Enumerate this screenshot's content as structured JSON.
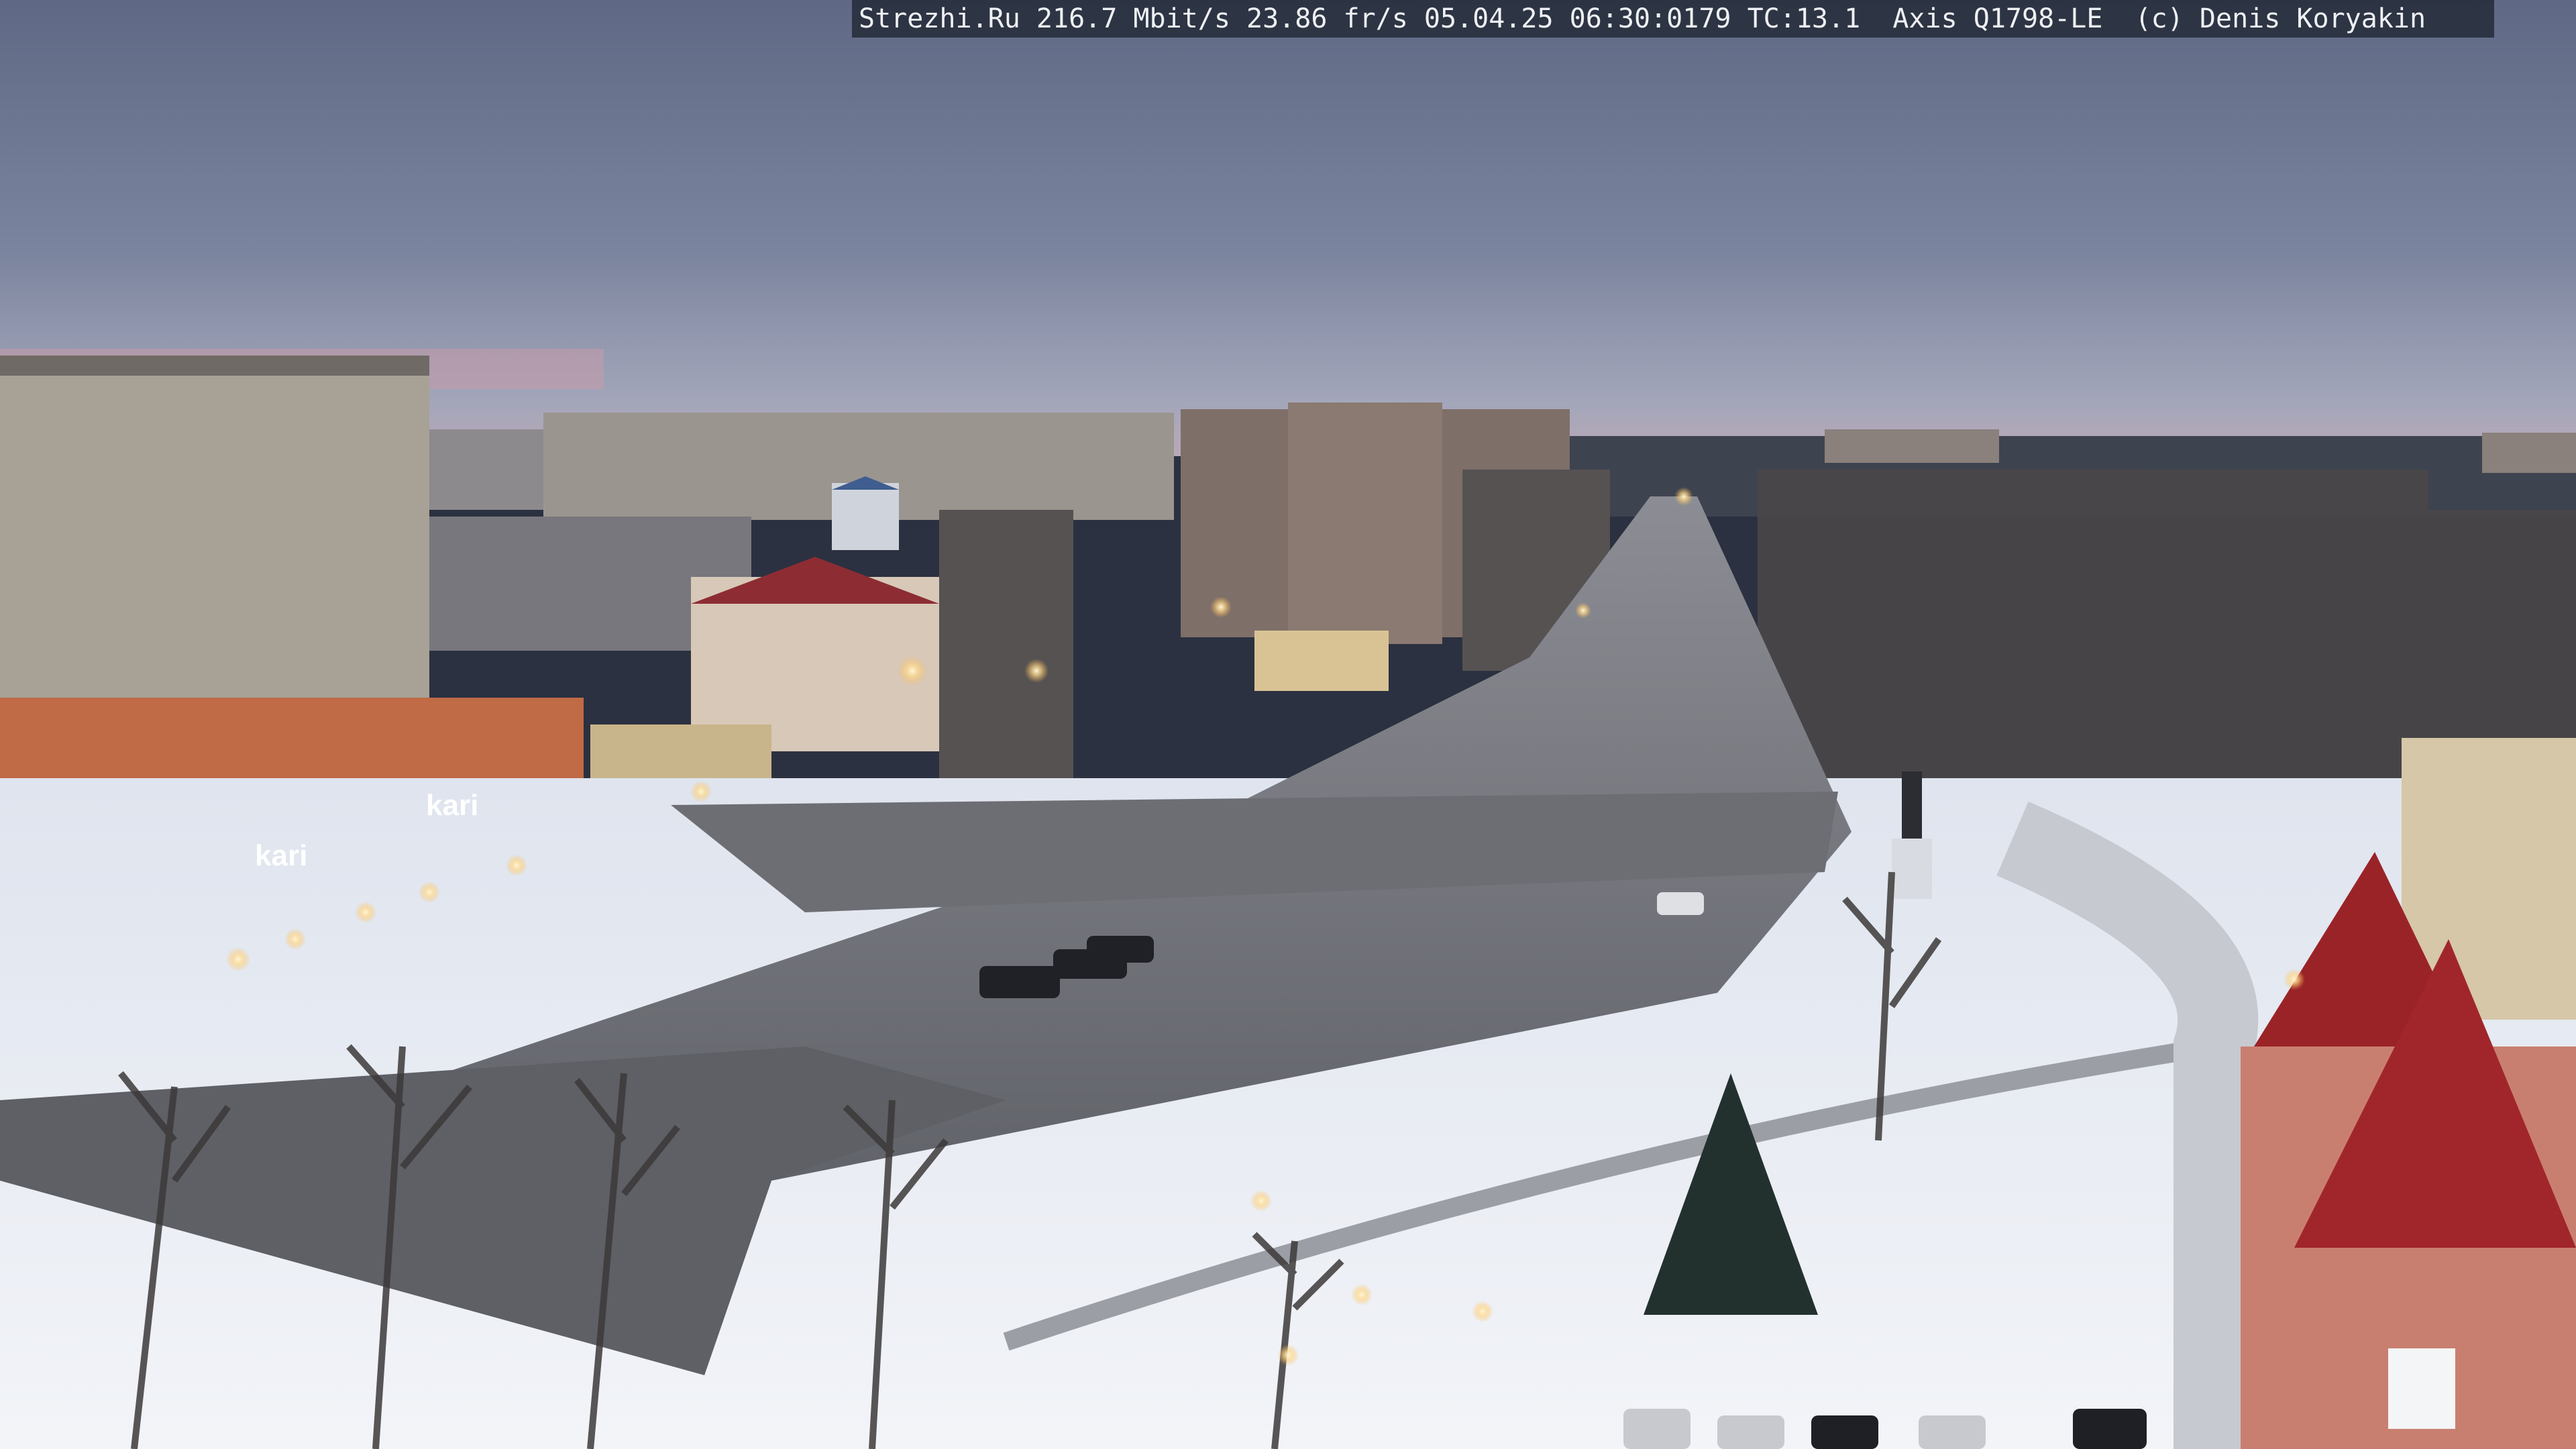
{
  "overlay": {
    "site": "Strezhi.Ru",
    "bitrate": "216.7 Mbit/s",
    "fps": "23.86 fr/s",
    "date": "05.04.25",
    "time": "06:30:0179",
    "tc": "TC:13.1",
    "camera": "Axis Q1798-LE",
    "copyright": "(c) Denis Koryakin"
  },
  "signs": {
    "store_left": "kari",
    "store_mid": "kari"
  },
  "colors": {
    "sky_top": "#6c7690",
    "sky_horizon": "#a9aec0",
    "snow": "#eef1f6",
    "road": "#5a5c63",
    "brick": "#b8573c",
    "roof_red": "#9a2a2a"
  }
}
